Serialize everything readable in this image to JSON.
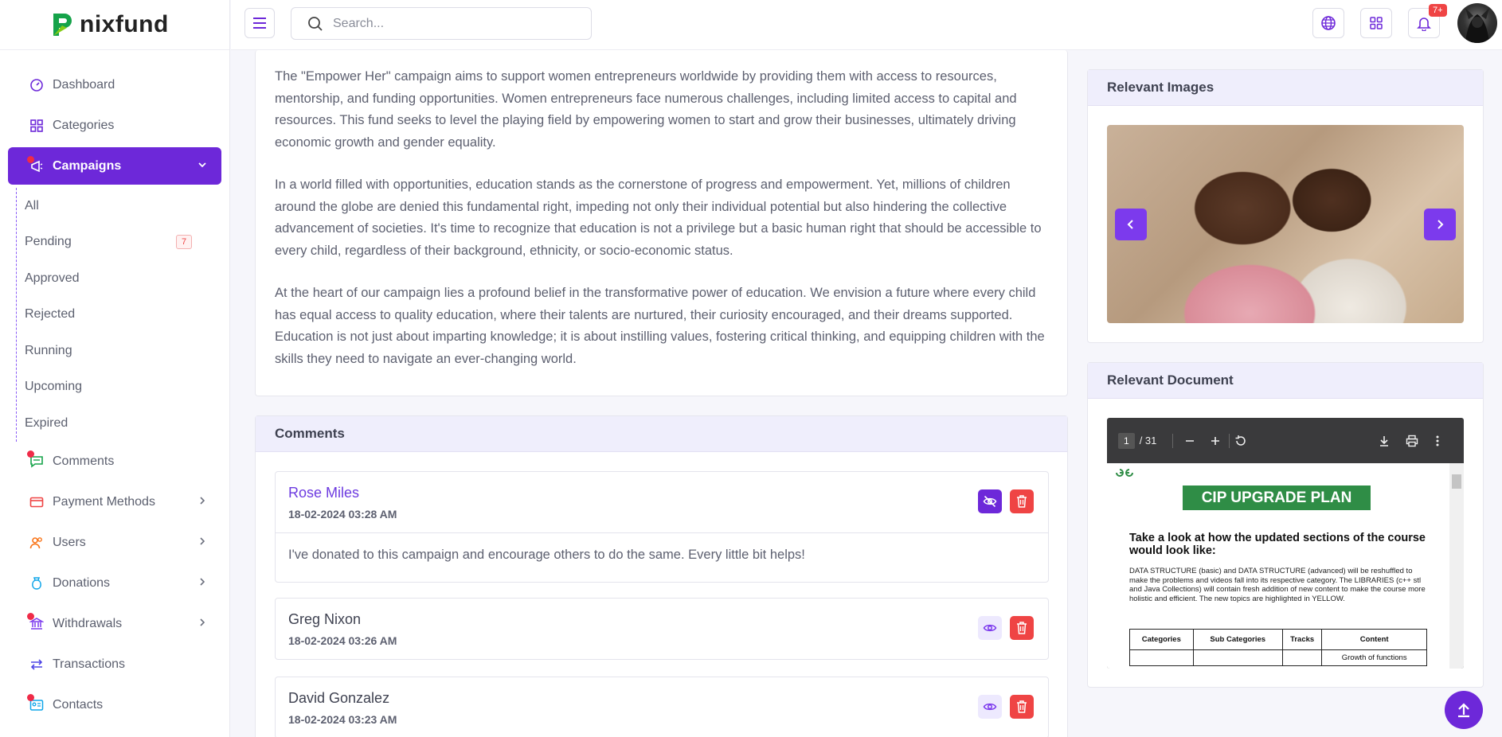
{
  "brand": {
    "name": "nixfund",
    "accent": "#6d28d9"
  },
  "search": {
    "placeholder": "Search..."
  },
  "topbar": {
    "notifications_badge": "7+"
  },
  "sidebar": {
    "items": [
      {
        "label": "Dashboard",
        "icon": "dashboard-icon"
      },
      {
        "label": "Categories",
        "icon": "grid-icon"
      },
      {
        "label": "Campaigns",
        "icon": "campaign-icon",
        "active": true
      },
      {
        "label": "Comments",
        "icon": "comments-icon"
      },
      {
        "label": "Payment Methods",
        "icon": "credit-card-icon"
      },
      {
        "label": "Users",
        "icon": "users-icon"
      },
      {
        "label": "Donations",
        "icon": "donation-icon"
      },
      {
        "label": "Withdrawals",
        "icon": "bank-icon"
      },
      {
        "label": "Transactions",
        "icon": "transfer-icon"
      },
      {
        "label": "Contacts",
        "icon": "contact-card-icon"
      }
    ],
    "campaign_sub": [
      {
        "label": "All"
      },
      {
        "label": "Pending",
        "badge": "7"
      },
      {
        "label": "Approved"
      },
      {
        "label": "Rejected"
      },
      {
        "label": "Running"
      },
      {
        "label": "Upcoming"
      },
      {
        "label": "Expired"
      }
    ]
  },
  "description": {
    "paragraphs": [
      "The \"Empower Her\" campaign aims to support women entrepreneurs worldwide by providing them with access to resources, mentorship, and funding opportunities. Women entrepreneurs face numerous challenges, including limited access to capital and resources. This fund seeks to level the playing field by empowering women to start and grow their businesses, ultimately driving economic growth and gender equality.",
      "In a world filled with opportunities, education stands as the cornerstone of progress and empowerment. Yet, millions of children around the globe are denied this fundamental right, impeding not only their individual potential but also hindering the collective advancement of societies. It's time to recognize that education is not a privilege but a basic human right that should be accessible to every child, regardless of their background, ethnicity, or socio-economic status.",
      "At the heart of our campaign lies a profound belief in the transformative power of education. We envision a future where every child has equal access to quality education, where their talents are nurtured, their curiosity encouraged, and their dreams supported. Education is not just about imparting knowledge; it is about instilling values, fostering critical thinking, and equipping children with the skills they need to navigate an ever-changing world."
    ]
  },
  "comments": {
    "title": "Comments",
    "list": [
      {
        "name": "Rose Miles",
        "date": "18-02-2024 03:28 AM",
        "text": "I've donated to this campaign and encourage others to do the same. Every little bit helps!"
      },
      {
        "name": "Greg Nixon",
        "date": "18-02-2024 03:26 AM"
      },
      {
        "name": "David Gonzalez",
        "date": "18-02-2024 03:23 AM"
      }
    ]
  },
  "images": {
    "title": "Relevant Images"
  },
  "document": {
    "title": "Relevant Document",
    "page_current": "1",
    "page_total": "/ 31",
    "pdf_heading": "CIP UPGRADE PLAN",
    "pdf_subheading": "Take a look at how the updated sections of the course would look like:",
    "pdf_paragraph": "DATA STRUCTURE (basic) and DATA STRUCTURE (advanced) will be reshuffled to make the problems and videos fall into its respective category. The LIBRARIES (c++ stl and Java Collections) will contain fresh addition of new content to make the course more holistic and efficient. The new topics are highlighted in YELLOW.",
    "pdf_table_headers": [
      "Categories",
      "Sub Categories",
      "Tracks",
      "Content"
    ],
    "pdf_table_cell": "Growth of functions"
  }
}
